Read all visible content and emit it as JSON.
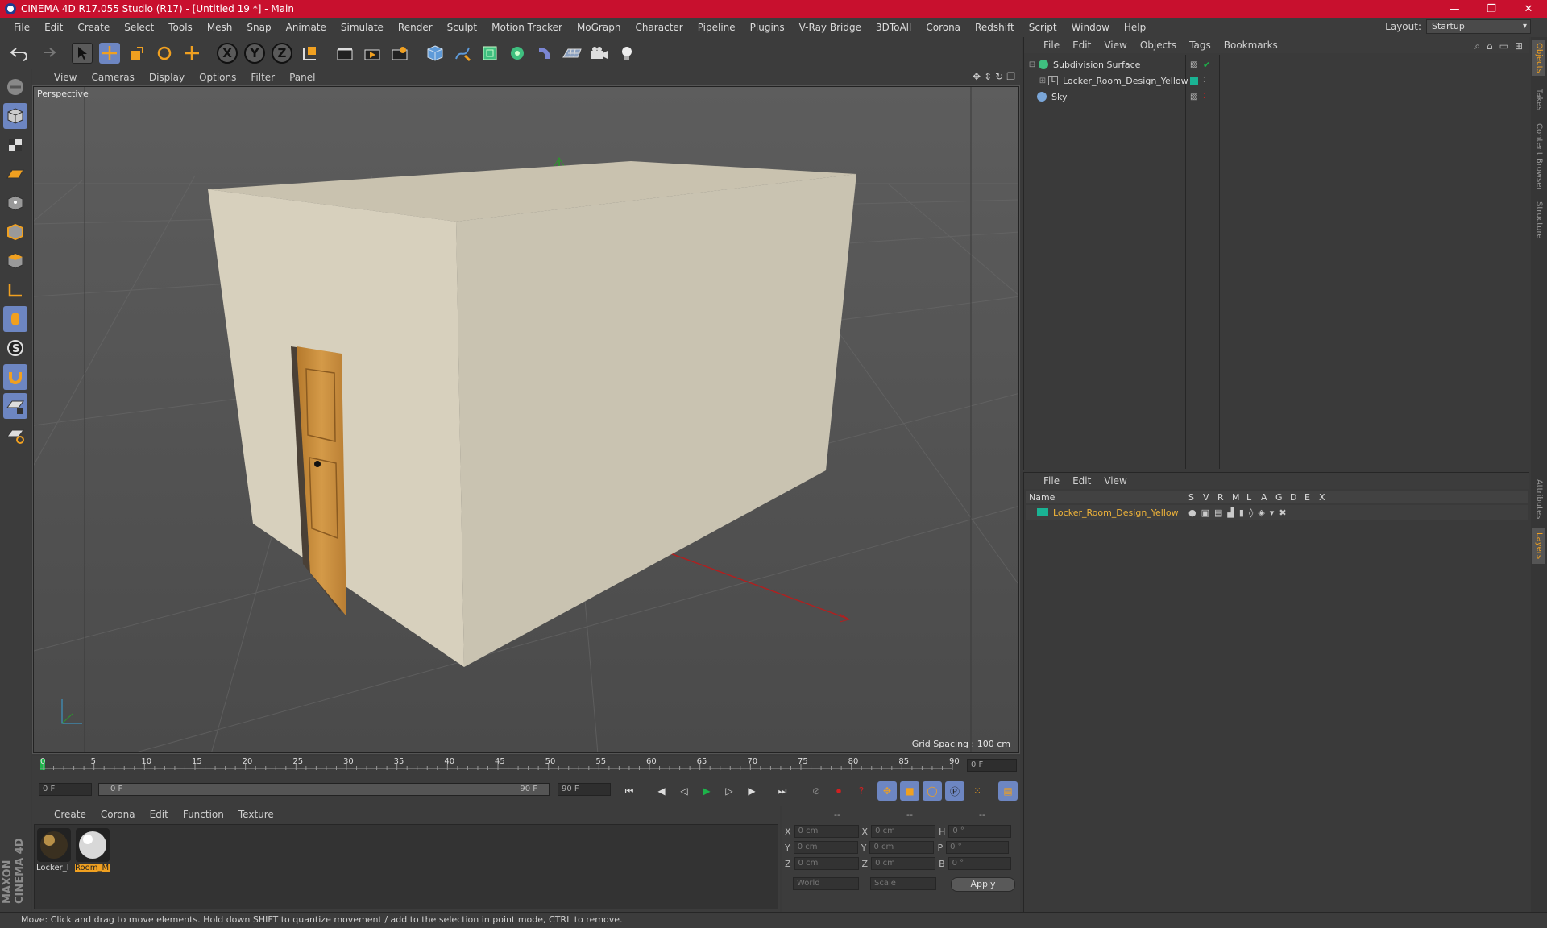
{
  "window": {
    "title": "CINEMA 4D R17.055 Studio (R17) - [Untitled 19 *] - Main",
    "buttons": [
      "—",
      "❐",
      "✕"
    ]
  },
  "menubar": {
    "items": [
      "File",
      "Edit",
      "Create",
      "Select",
      "Tools",
      "Mesh",
      "Snap",
      "Animate",
      "Simulate",
      "Render",
      "Sculpt",
      "Motion Tracker",
      "MoGraph",
      "Character",
      "Pipeline",
      "Plugins",
      "V-Ray Bridge",
      "3DToAll",
      "Corona",
      "Redshift",
      "Script",
      "Window",
      "Help"
    ],
    "layout_label": "Layout:",
    "layout_value": "Startup"
  },
  "viewport": {
    "menu": [
      "View",
      "Cameras",
      "Display",
      "Options",
      "Filter",
      "Panel"
    ],
    "label": "Perspective",
    "grid_spacing": "Grid Spacing : 100 cm"
  },
  "timeline": {
    "ticks": [
      "0",
      "5",
      "10",
      "15",
      "20",
      "25",
      "30",
      "35",
      "40",
      "45",
      "50",
      "55",
      "60",
      "65",
      "70",
      "75",
      "80",
      "85",
      "90"
    ],
    "current_frame": "0 F"
  },
  "transport": {
    "start": "0 F",
    "range_start": "0 F",
    "range_end": "90 F",
    "end": "90 F"
  },
  "materials": {
    "menu": [
      "Create",
      "Corona",
      "Edit",
      "Function",
      "Texture"
    ],
    "items": [
      {
        "label": "Locker_I"
      },
      {
        "label": "Room_M"
      }
    ]
  },
  "coordinates": {
    "headers": [
      "--",
      "--",
      "--"
    ],
    "rows": [
      {
        "a": "X",
        "av": "0 cm",
        "b": "X",
        "bv": "0 cm",
        "c": "H",
        "cv": "0 °"
      },
      {
        "a": "Y",
        "av": "0 cm",
        "b": "Y",
        "bv": "0 cm",
        "c": "P",
        "cv": "0 °"
      },
      {
        "a": "Z",
        "av": "0 cm",
        "b": "Z",
        "bv": "0 cm",
        "c": "B",
        "cv": "0 °"
      }
    ],
    "space": "World",
    "mode": "Scale",
    "apply": "Apply"
  },
  "objects": {
    "menu": [
      "File",
      "Edit",
      "View",
      "Objects",
      "Tags",
      "Bookmarks"
    ],
    "rows": [
      {
        "name": "Subdivision Surface"
      },
      {
        "name": "Locker_Room_Design_Yellow"
      },
      {
        "name": "Sky"
      }
    ]
  },
  "layers": {
    "menu": [
      "File",
      "Edit",
      "View"
    ],
    "columns": [
      "Name",
      "S",
      "V",
      "R",
      "M",
      "L",
      "A",
      "G",
      "D",
      "E",
      "X"
    ],
    "row": "Locker_Room_Design_Yellow"
  },
  "side_tabs": [
    "Objects",
    "Takes",
    "Content Browser",
    "Structure",
    "Attributes",
    "Layers"
  ],
  "status": "Move: Click and drag to move elements. Hold down SHIFT to quantize movement / add to the selection in point mode, CTRL to remove.",
  "logo": "MAXON CINEMA 4D",
  "colors": {
    "accent": "#c8102e",
    "layer_color": "#1ab394",
    "selected_text": "#f0b43a"
  }
}
